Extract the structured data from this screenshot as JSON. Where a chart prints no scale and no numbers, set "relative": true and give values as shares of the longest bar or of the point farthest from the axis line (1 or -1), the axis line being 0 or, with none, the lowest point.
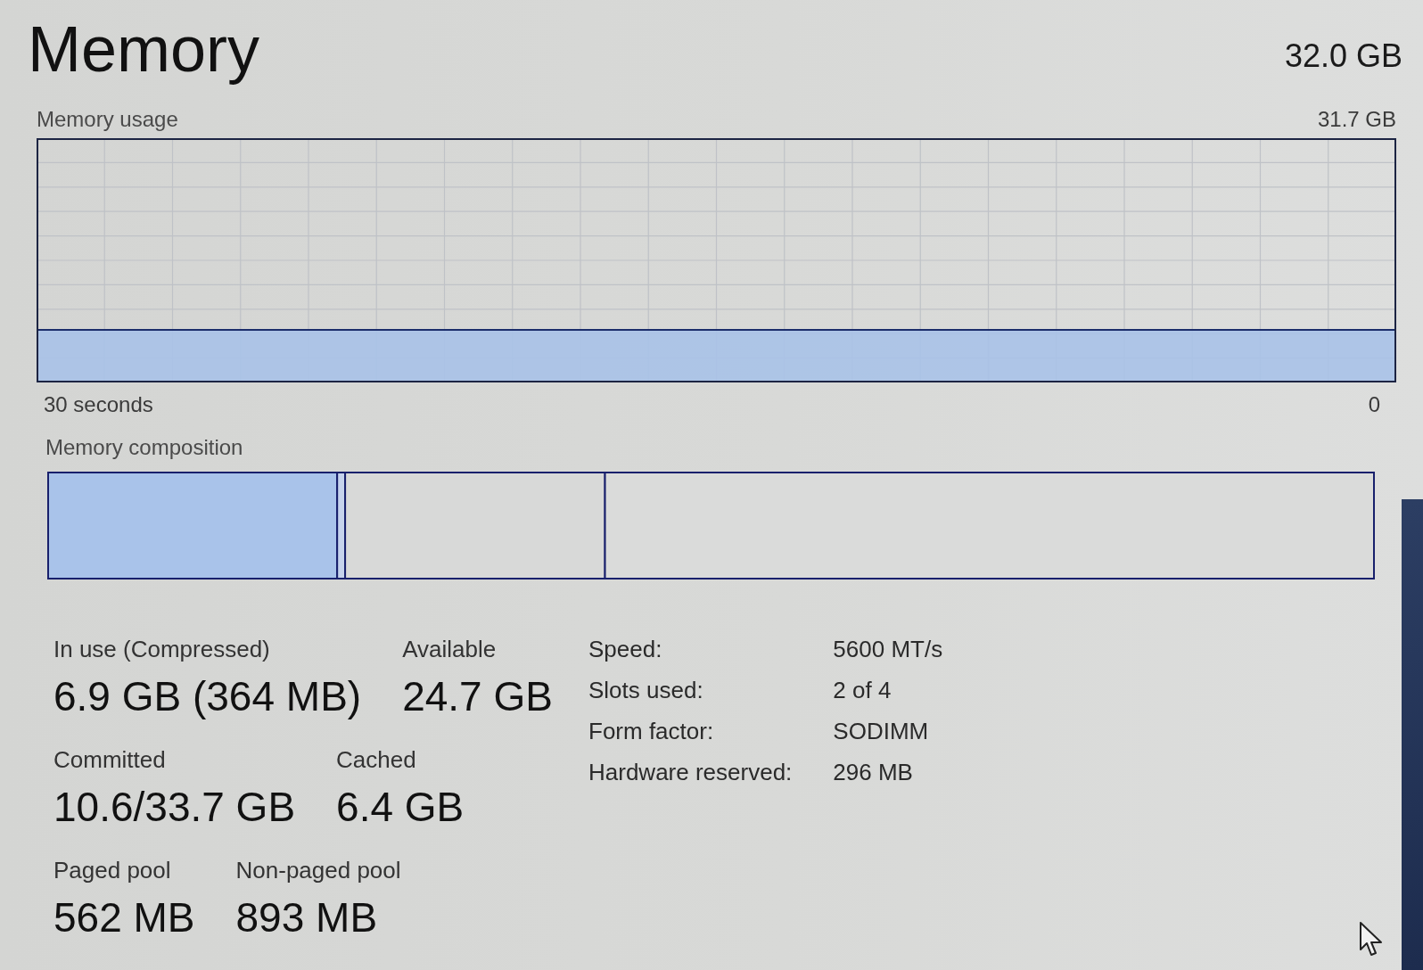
{
  "header": {
    "title": "Memory",
    "capacity": "32.0 GB"
  },
  "usage": {
    "title": "Memory usage",
    "max_label": "31.7 GB",
    "time_label": "30 seconds",
    "min_label": "0"
  },
  "composition": {
    "chart_data": [
      {
        "type": "bar",
        "title": "Memory composition",
        "orientation": "horizontal",
        "stacked": true,
        "relative": true,
        "categories": [
          null
        ],
        "series": [
          {
            "color": "#a9c3ea",
            "values": [
              0.218
            ]
          },
          {
            "color": "#c6d3ec",
            "values": [
              0.006
            ]
          },
          {
            "color": "#d8d9d8",
            "values": [
              0.196
            ]
          },
          {
            "color": "#dadbda",
            "values": [
              0.58
            ]
          }
        ]
      }
    ]
  },
  "stat_rows": [
    {
      "stats": [
        {
          "label": "In use (Compressed)",
          "value": "6.9 GB (364 MB)"
        },
        {
          "label": "Available",
          "value": "24.7 GB"
        }
      ]
    },
    {
      "stats": [
        {
          "label": "Committed",
          "value": "10.6/33.7 GB"
        },
        {
          "label": "Cached",
          "value": "6.4 GB"
        }
      ]
    },
    {
      "stats": [
        {
          "label": "Paged pool",
          "value": "562 MB"
        },
        {
          "label": "Non-paged pool",
          "value": "893 MB"
        }
      ]
    }
  ],
  "details": [
    {
      "label": "Speed:",
      "value": "5600 MT/s"
    },
    {
      "label": "Slots used:",
      "value": "2 of 4"
    },
    {
      "label": "Form factor:",
      "value": "SODIMM"
    },
    {
      "label": "Hardware reserved:",
      "value": "296 MB"
    }
  ]
}
